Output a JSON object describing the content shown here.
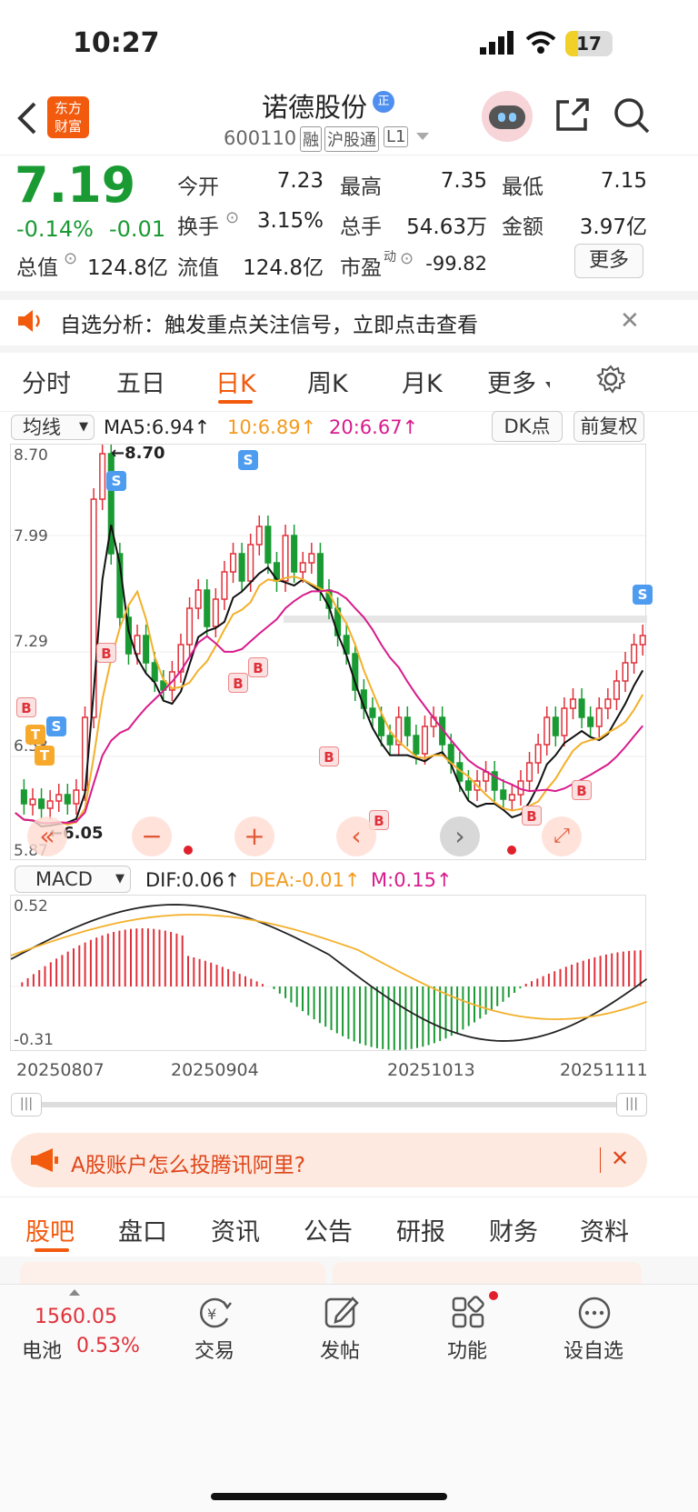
{
  "status_bar": {
    "time": "10:27",
    "battery": "17"
  },
  "header": {
    "logo_top": "东方",
    "logo_bottom": "财富",
    "stock_name": "诺德股份",
    "stock_code": "600110",
    "tags": [
      "融",
      "沪股通",
      "L1"
    ]
  },
  "quote": {
    "price": "7.19",
    "change_pct": "-0.14%",
    "change": "-0.01",
    "open_label": "今开",
    "open": "7.23",
    "high_label": "最高",
    "high": "7.35",
    "low_label": "最低",
    "low": "7.15",
    "turnover_label": "换手",
    "turnover": "3.15%",
    "volume_label": "总手",
    "volume": "54.63万",
    "amount_label": "金额",
    "amount": "3.97亿",
    "mktcap_label": "总值",
    "mktcap": "124.8亿",
    "float_label": "流值",
    "float": "124.8亿",
    "pe_label": "市盈",
    "pe_sup": "动",
    "pe": "-99.82",
    "more": "更多"
  },
  "notice": {
    "text": "自选分析：触发重点关注信号，立即点击查看"
  },
  "chart_tabs": [
    "分时",
    "五日",
    "日K",
    "周K",
    "月K",
    "更多"
  ],
  "active_tab": "日K",
  "indicator": {
    "select": "均线",
    "ma5": "MA5:6.94↑",
    "ma10": "10:6.89↑",
    "ma20": "20:6.67↑",
    "dk": "DK点",
    "fq": "前复权"
  },
  "axis": {
    "p1": "8.70",
    "p2": "7.99",
    "p3": "7.29",
    "p4": "6.58",
    "p5": "5.87",
    "hi_mark": "←8.70",
    "lo_mark": "←6.05"
  },
  "macd": {
    "select": "MACD",
    "dif": "DIF:0.06↑",
    "dea": "DEA:-0.01↑",
    "m": "M:0.15↑",
    "top": "0.52",
    "bottom": "-0.31"
  },
  "dates": [
    "20250807",
    "20250904",
    "20251013",
    "20251111"
  ],
  "ad": {
    "text": "A股账户怎么投腾讯阿里?"
  },
  "bottom_tabs": [
    "股吧",
    "盘口",
    "资讯",
    "公告",
    "研报",
    "财务",
    "资料"
  ],
  "nav": {
    "index_value": "1560.05",
    "index_name": "电池",
    "index_pct": "0.53%",
    "trade": "交易",
    "post": "发帖",
    "func": "功能",
    "watch": "设自选"
  },
  "colors": {
    "red": "#e0313a",
    "green": "#1a9a33",
    "accent": "#f25a0d"
  }
}
